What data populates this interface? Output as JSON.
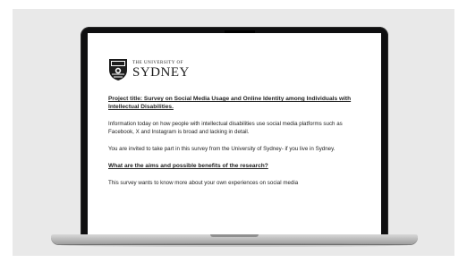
{
  "logo": {
    "small_text": "THE UNIVERSITY OF",
    "large_text": "SYDNEY"
  },
  "document": {
    "project_title": "Project title: Survey on Social Media Usage and Online Identity among Individuals with Intellectual Disabilities.",
    "paragraph_1": "Information today on how people with intellectual disabilities use social media platforms such as Facebook, X and Instagram is broad and lacking in detail.",
    "paragraph_2": "You are invited to take part in this survey from the University of Sydney- if you live in Sydney.",
    "section_heading": "What are the aims and possible benefits of the research?",
    "paragraph_3": "This survey wants to know more about your own experiences on social media"
  }
}
